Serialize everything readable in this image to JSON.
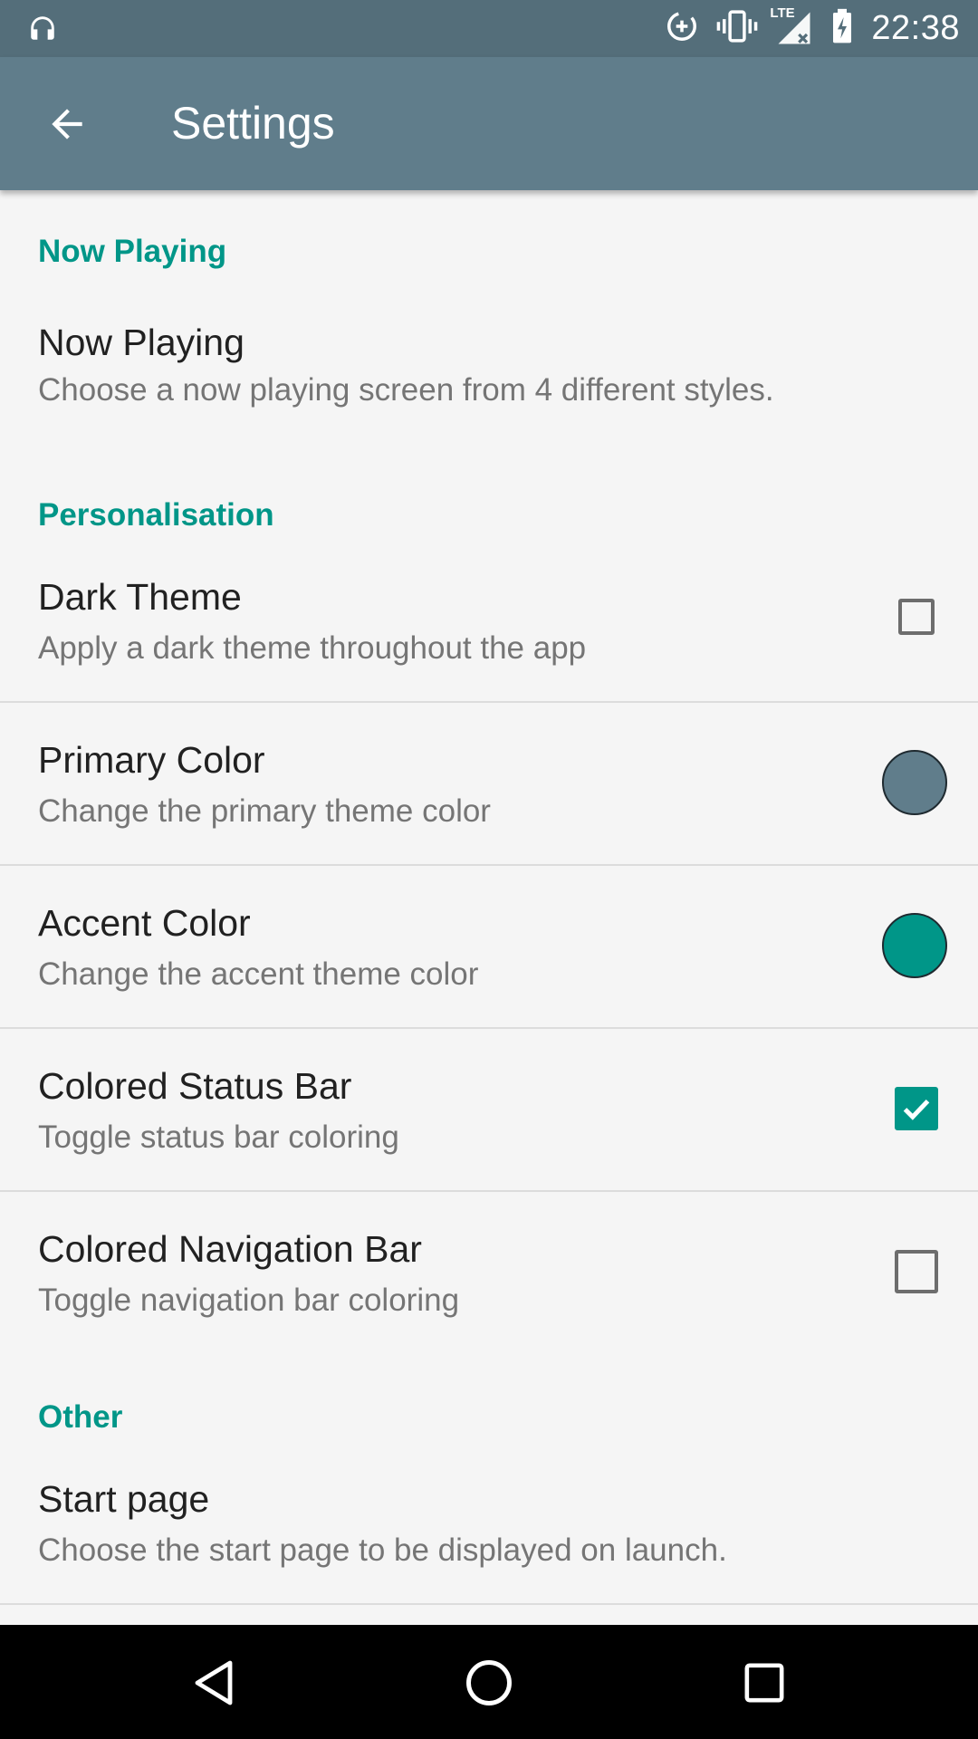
{
  "status_bar": {
    "time": "22:38",
    "left_icons": [
      "headphones-icon"
    ],
    "right_icons": [
      "data-saver-icon",
      "vibrate-icon",
      "lte-signal-icon",
      "battery-icon"
    ],
    "network_label": "LTE"
  },
  "toolbar": {
    "title": "Settings",
    "back_icon": "arrow-back-icon"
  },
  "sections": {
    "now_playing": {
      "header": "Now Playing",
      "items": [
        {
          "title": "Now Playing",
          "summary": "Choose a now playing screen from 4 different styles."
        }
      ]
    },
    "personalisation": {
      "header": "Personalisation",
      "items": [
        {
          "title": "Dark Theme",
          "summary": "Apply a dark theme throughout the app",
          "widget": "checkbox",
          "checked": false
        },
        {
          "title": "Primary Color",
          "summary": "Change the primary theme color",
          "widget": "color-swatch",
          "color": "#607d8b"
        },
        {
          "title": "Accent Color",
          "summary": "Change the accent theme color",
          "widget": "color-swatch",
          "color": "#009688"
        },
        {
          "title": "Colored Status Bar",
          "summary": "Toggle status bar coloring",
          "widget": "checkbox",
          "checked": true
        },
        {
          "title": "Colored Navigation Bar",
          "summary": "Toggle navigation bar coloring",
          "widget": "checkbox",
          "checked": false
        }
      ]
    },
    "other": {
      "header": "Other",
      "items": [
        {
          "title": "Start page",
          "summary": "Choose the start page to be displayed on launch."
        }
      ]
    }
  },
  "nav_bar": {
    "buttons": [
      "back-triangle-icon",
      "home-circle-icon",
      "recents-square-icon"
    ]
  },
  "colors": {
    "status_bar": "#546e7a",
    "toolbar": "#607d8b",
    "accent": "#009688",
    "background": "#f5f5f5"
  }
}
